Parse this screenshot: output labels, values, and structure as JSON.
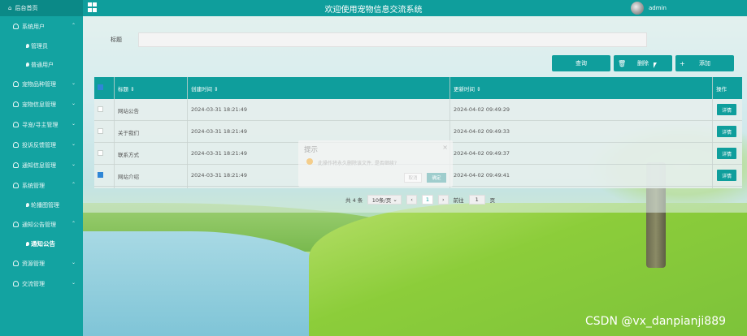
{
  "topbar": {
    "home_label": "后台首页",
    "title": "欢迎使用宠物信息交流系统",
    "username": "admin"
  },
  "sidebar": {
    "items": [
      {
        "label": "系统用户",
        "expanded": true
      },
      {
        "label": "管理员"
      },
      {
        "label": "普通用户"
      },
      {
        "label": "宠物品种管理"
      },
      {
        "label": "宠物信息管理"
      },
      {
        "label": "寻宠/寻主管理"
      },
      {
        "label": "投诉反馈管理"
      },
      {
        "label": "通知信息管理"
      },
      {
        "label": "系统管理"
      },
      {
        "label": "轮播图管理"
      },
      {
        "label": "通知公告管理"
      },
      {
        "label": "通知公告"
      },
      {
        "label": "资源管理"
      },
      {
        "label": "交流管理"
      }
    ]
  },
  "search": {
    "label": "标题",
    "value": ""
  },
  "toolbar": {
    "query_label": "查询",
    "delete_label": "删除",
    "add_label": "添加"
  },
  "table": {
    "columns": [
      "标题",
      "创建时间",
      "更新时间",
      "操作"
    ],
    "sort_glyph": "⇕",
    "rows": [
      {
        "title": "网站公告",
        "created": "2024-03-31 18:21:49",
        "updated": "2024-04-02 09:49:29",
        "checked": false,
        "action": "详情"
      },
      {
        "title": "关于我们",
        "created": "2024-03-31 18:21:49",
        "updated": "2024-04-02 09:49:33",
        "checked": false,
        "action": "详情"
      },
      {
        "title": "联系方式",
        "created": "2024-03-31 18:21:49",
        "updated": "2024-04-02 09:49:37",
        "checked": false,
        "action": "详情"
      },
      {
        "title": "网站介绍",
        "created": "2024-03-31 18:21:49",
        "updated": "2024-04-02 09:49:41",
        "checked": true,
        "action": "详情"
      }
    ]
  },
  "pager": {
    "total": "共 4 条",
    "page_size": "10条/页",
    "prev": "‹",
    "current_page": "1",
    "next": "›",
    "goto_label": "前往",
    "goto_value": "1",
    "page_suffix": "页"
  },
  "dialog": {
    "title": "提示",
    "close": "×",
    "message": "此操作将永久删除该文件, 是否继续?",
    "cancel_label": "取消",
    "confirm_label": "确定"
  },
  "watermark": "CSDN @vx_danpianji889",
  "colors": {
    "primary": "#0f9e9c",
    "sidebar": "#13a3a1",
    "checkbox": "#2f86d6"
  }
}
